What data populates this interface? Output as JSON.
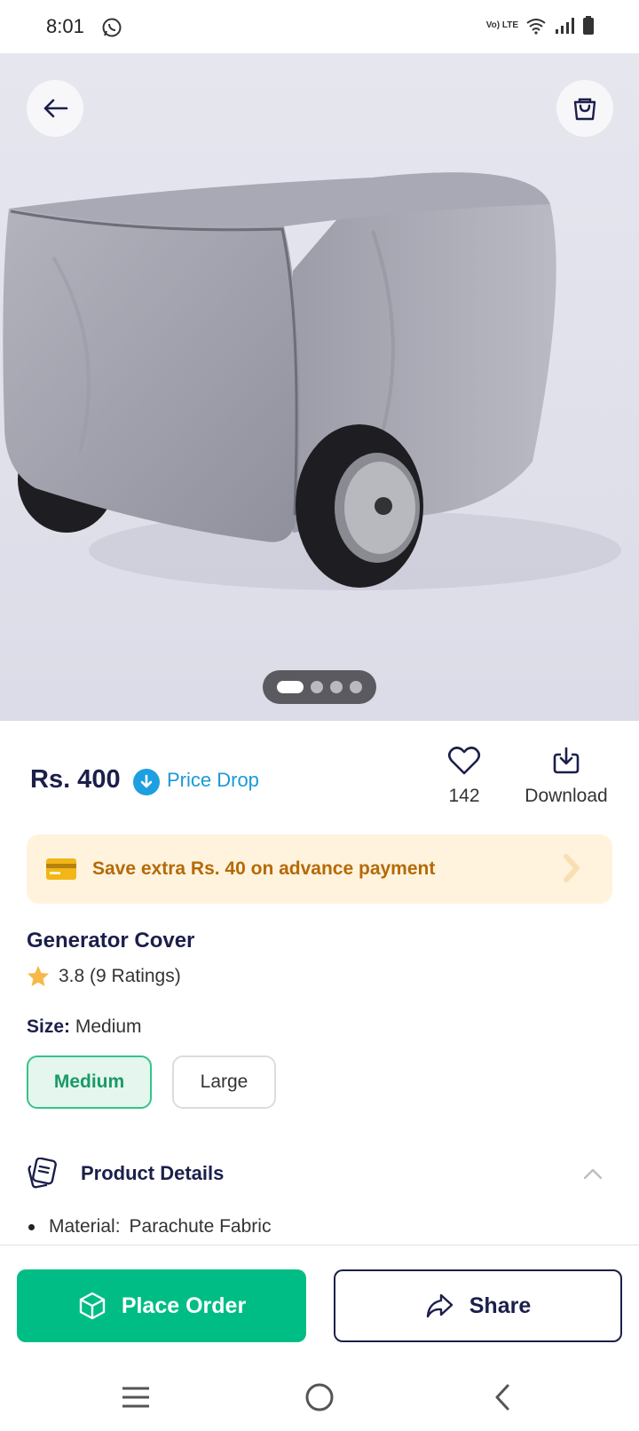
{
  "status_bar": {
    "time": "8:01",
    "network_label": "Vo) LTE"
  },
  "hero": {
    "carousel_total": 4,
    "carousel_active": 1
  },
  "product": {
    "price": "Rs. 400",
    "price_drop_label": "Price Drop",
    "wishlist_count": "142",
    "download_label": "Download",
    "offer_text": "Save extra Rs. 40 on advance payment",
    "title": "Generator Cover",
    "rating_text": "3.8 (9 Ratings)",
    "size_label": "Size:",
    "size_selected": "Medium",
    "size_options": [
      "Medium",
      "Large"
    ]
  },
  "product_details": {
    "heading": "Product Details",
    "items": [
      {
        "key": "Material:",
        "value": "Parachute Fabric"
      }
    ]
  },
  "actions": {
    "place_order_label": "Place Order",
    "share_label": "Share"
  },
  "colors": {
    "brand_green": "#00bd85",
    "navy": "#1b1f4a",
    "price_drop_blue": "#1a9ad8",
    "offer_bg": "#fff3de",
    "offer_text": "#b56a05"
  }
}
